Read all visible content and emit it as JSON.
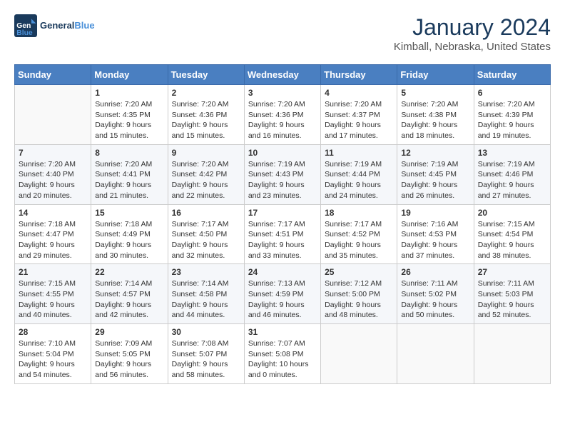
{
  "header": {
    "logo_general": "General",
    "logo_blue": "Blue",
    "title": "January 2024",
    "subtitle": "Kimball, Nebraska, United States"
  },
  "calendar": {
    "days_of_week": [
      "Sunday",
      "Monday",
      "Tuesday",
      "Wednesday",
      "Thursday",
      "Friday",
      "Saturday"
    ],
    "weeks": [
      [
        {
          "day": "",
          "info": ""
        },
        {
          "day": "1",
          "info": "Sunrise: 7:20 AM\nSunset: 4:35 PM\nDaylight: 9 hours\nand 15 minutes."
        },
        {
          "day": "2",
          "info": "Sunrise: 7:20 AM\nSunset: 4:36 PM\nDaylight: 9 hours\nand 15 minutes."
        },
        {
          "day": "3",
          "info": "Sunrise: 7:20 AM\nSunset: 4:36 PM\nDaylight: 9 hours\nand 16 minutes."
        },
        {
          "day": "4",
          "info": "Sunrise: 7:20 AM\nSunset: 4:37 PM\nDaylight: 9 hours\nand 17 minutes."
        },
        {
          "day": "5",
          "info": "Sunrise: 7:20 AM\nSunset: 4:38 PM\nDaylight: 9 hours\nand 18 minutes."
        },
        {
          "day": "6",
          "info": "Sunrise: 7:20 AM\nSunset: 4:39 PM\nDaylight: 9 hours\nand 19 minutes."
        }
      ],
      [
        {
          "day": "7",
          "info": "Sunrise: 7:20 AM\nSunset: 4:40 PM\nDaylight: 9 hours\nand 20 minutes."
        },
        {
          "day": "8",
          "info": "Sunrise: 7:20 AM\nSunset: 4:41 PM\nDaylight: 9 hours\nand 21 minutes."
        },
        {
          "day": "9",
          "info": "Sunrise: 7:20 AM\nSunset: 4:42 PM\nDaylight: 9 hours\nand 22 minutes."
        },
        {
          "day": "10",
          "info": "Sunrise: 7:19 AM\nSunset: 4:43 PM\nDaylight: 9 hours\nand 23 minutes."
        },
        {
          "day": "11",
          "info": "Sunrise: 7:19 AM\nSunset: 4:44 PM\nDaylight: 9 hours\nand 24 minutes."
        },
        {
          "day": "12",
          "info": "Sunrise: 7:19 AM\nSunset: 4:45 PM\nDaylight: 9 hours\nand 26 minutes."
        },
        {
          "day": "13",
          "info": "Sunrise: 7:19 AM\nSunset: 4:46 PM\nDaylight: 9 hours\nand 27 minutes."
        }
      ],
      [
        {
          "day": "14",
          "info": "Sunrise: 7:18 AM\nSunset: 4:47 PM\nDaylight: 9 hours\nand 29 minutes."
        },
        {
          "day": "15",
          "info": "Sunrise: 7:18 AM\nSunset: 4:49 PM\nDaylight: 9 hours\nand 30 minutes."
        },
        {
          "day": "16",
          "info": "Sunrise: 7:17 AM\nSunset: 4:50 PM\nDaylight: 9 hours\nand 32 minutes."
        },
        {
          "day": "17",
          "info": "Sunrise: 7:17 AM\nSunset: 4:51 PM\nDaylight: 9 hours\nand 33 minutes."
        },
        {
          "day": "18",
          "info": "Sunrise: 7:17 AM\nSunset: 4:52 PM\nDaylight: 9 hours\nand 35 minutes."
        },
        {
          "day": "19",
          "info": "Sunrise: 7:16 AM\nSunset: 4:53 PM\nDaylight: 9 hours\nand 37 minutes."
        },
        {
          "day": "20",
          "info": "Sunrise: 7:15 AM\nSunset: 4:54 PM\nDaylight: 9 hours\nand 38 minutes."
        }
      ],
      [
        {
          "day": "21",
          "info": "Sunrise: 7:15 AM\nSunset: 4:55 PM\nDaylight: 9 hours\nand 40 minutes."
        },
        {
          "day": "22",
          "info": "Sunrise: 7:14 AM\nSunset: 4:57 PM\nDaylight: 9 hours\nand 42 minutes."
        },
        {
          "day": "23",
          "info": "Sunrise: 7:14 AM\nSunset: 4:58 PM\nDaylight: 9 hours\nand 44 minutes."
        },
        {
          "day": "24",
          "info": "Sunrise: 7:13 AM\nSunset: 4:59 PM\nDaylight: 9 hours\nand 46 minutes."
        },
        {
          "day": "25",
          "info": "Sunrise: 7:12 AM\nSunset: 5:00 PM\nDaylight: 9 hours\nand 48 minutes."
        },
        {
          "day": "26",
          "info": "Sunrise: 7:11 AM\nSunset: 5:02 PM\nDaylight: 9 hours\nand 50 minutes."
        },
        {
          "day": "27",
          "info": "Sunrise: 7:11 AM\nSunset: 5:03 PM\nDaylight: 9 hours\nand 52 minutes."
        }
      ],
      [
        {
          "day": "28",
          "info": "Sunrise: 7:10 AM\nSunset: 5:04 PM\nDaylight: 9 hours\nand 54 minutes."
        },
        {
          "day": "29",
          "info": "Sunrise: 7:09 AM\nSunset: 5:05 PM\nDaylight: 9 hours\nand 56 minutes."
        },
        {
          "day": "30",
          "info": "Sunrise: 7:08 AM\nSunset: 5:07 PM\nDaylight: 9 hours\nand 58 minutes."
        },
        {
          "day": "31",
          "info": "Sunrise: 7:07 AM\nSunset: 5:08 PM\nDaylight: 10 hours\nand 0 minutes."
        },
        {
          "day": "",
          "info": ""
        },
        {
          "day": "",
          "info": ""
        },
        {
          "day": "",
          "info": ""
        }
      ]
    ]
  }
}
